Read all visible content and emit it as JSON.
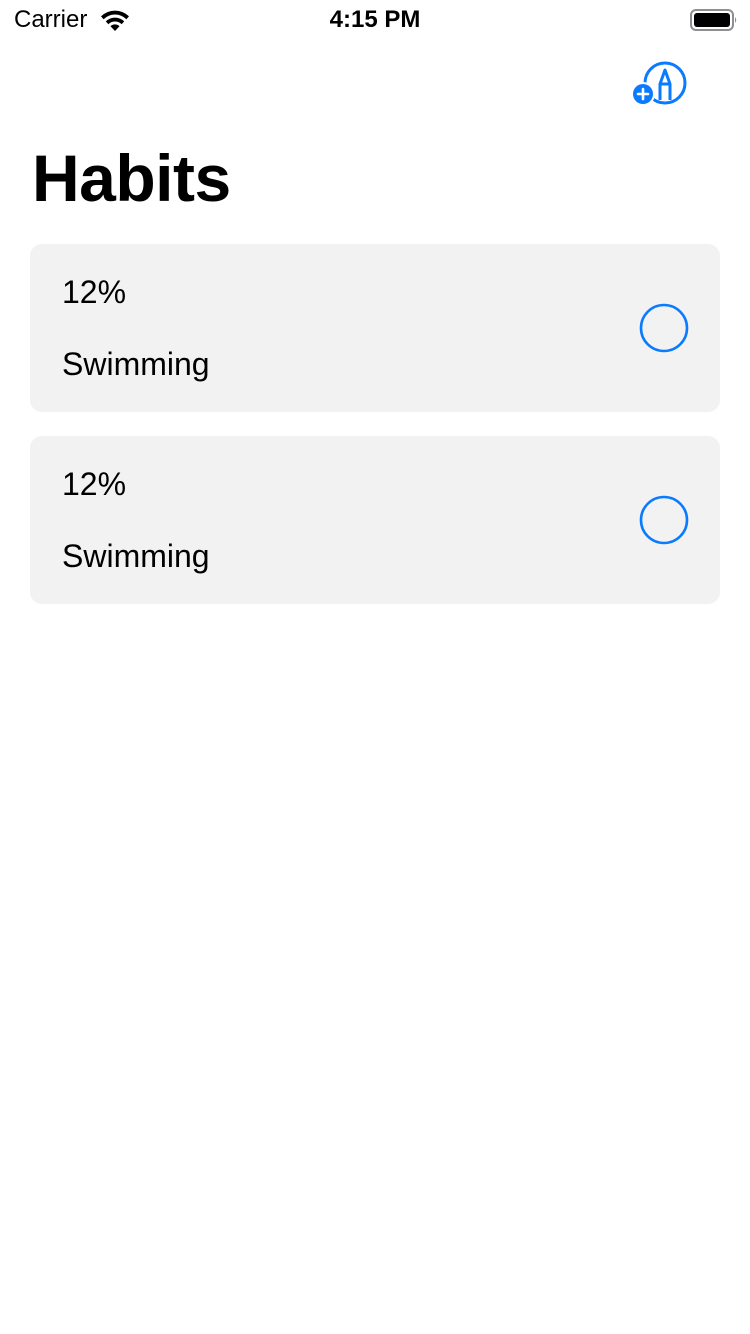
{
  "status_bar": {
    "carrier": "Carrier",
    "time": "4:15 PM"
  },
  "nav": {
    "add_icon": "add-habit-icon",
    "accent_color": "#0a7aff"
  },
  "page": {
    "title": "Habits"
  },
  "habits": [
    {
      "progress": "12%",
      "name": "Swimming",
      "completed": false
    },
    {
      "progress": "12%",
      "name": "Swimming",
      "completed": false
    }
  ],
  "colors": {
    "card_background": "#f2f2f2",
    "accent": "#0a7aff",
    "text": "#000000"
  }
}
